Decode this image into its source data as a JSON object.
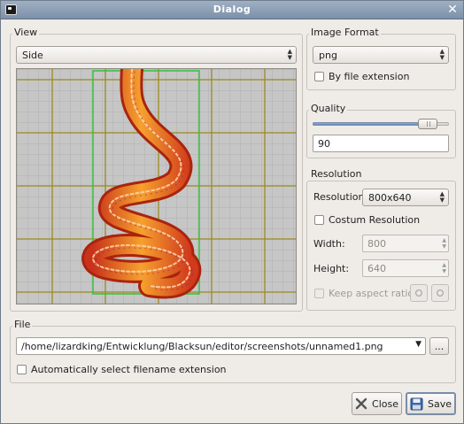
{
  "window": {
    "title": "Dialog",
    "icon": "window-menu-icon",
    "close_glyph": "✕"
  },
  "view": {
    "group_label": "View",
    "mode_value": "Side"
  },
  "image_format": {
    "group_label": "Image Format",
    "format_value": "png",
    "by_extension_label": "By file extension"
  },
  "quality": {
    "group_label": "Quality",
    "value": "90",
    "slider_fraction": 0.9
  },
  "resolution": {
    "group_label": "Resolution",
    "resolution_label": "Resolution:",
    "resolution_value": "800x640",
    "custom_label": "Costum Resolution",
    "width_label": "Width:",
    "width_value": "800",
    "height_label": "Height:",
    "height_value": "640",
    "keep_aspect_label": "Keep aspect ratio"
  },
  "file": {
    "group_label": "File",
    "path_value": "/home/lizardking/Entwicklung/Blacksun/editor/screenshots/unnamed1.png",
    "browse_label": "...",
    "auto_ext_label": "Automatically select filename extension"
  },
  "buttons": {
    "close_label": "Close",
    "save_label": "Save"
  },
  "colors": {
    "accent": "#5e86bc",
    "grid_major": "#9a8a1e",
    "selection_box": "#35c23a",
    "model": "#e8562a"
  }
}
